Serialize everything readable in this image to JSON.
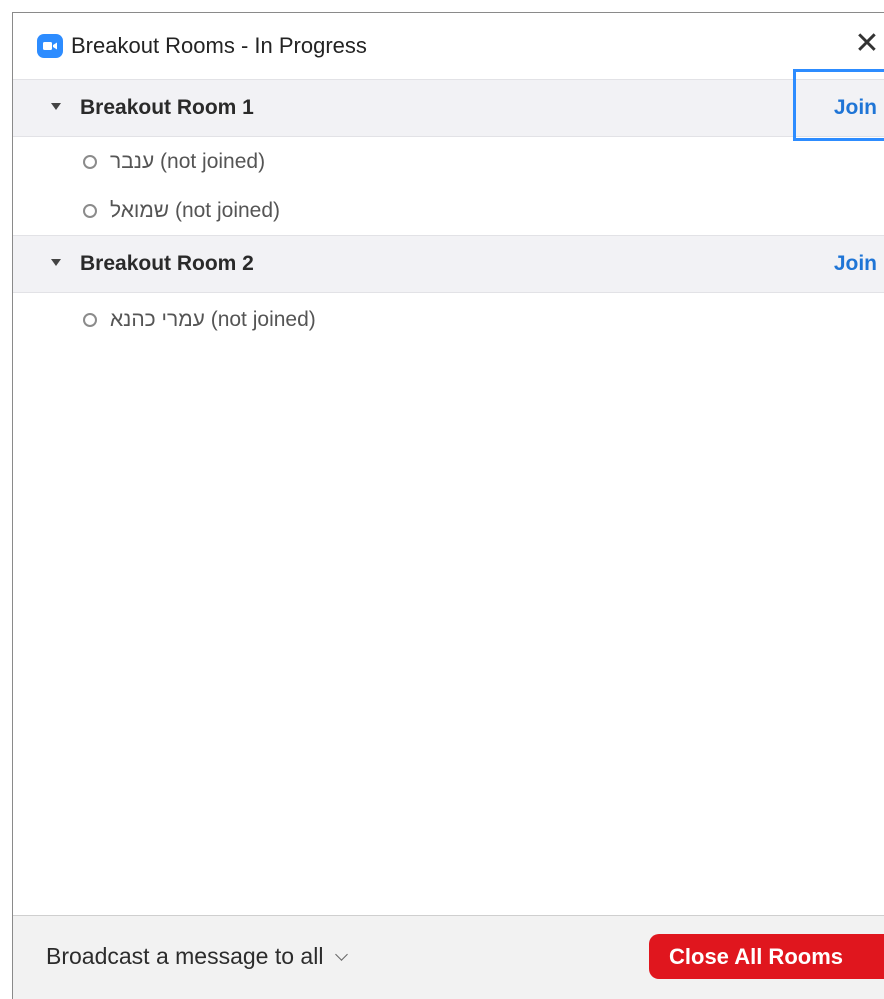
{
  "window": {
    "title": "Breakout Rooms - In Progress",
    "close_symbol": "✕"
  },
  "rooms": [
    {
      "name": "Breakout Room 1",
      "join_label": "Join",
      "participants": [
        {
          "name": "ענבר",
          "status": "(not joined)"
        },
        {
          "name": "שמואל",
          "status": "(not joined)"
        }
      ]
    },
    {
      "name": "Breakout Room 2",
      "join_label": "Join",
      "participants": [
        {
          "name": "עמרי כהנא",
          "status": "(not joined)"
        }
      ]
    }
  ],
  "footer": {
    "broadcast_label": "Broadcast a message to all",
    "close_all_label": "Close All Rooms"
  },
  "colors": {
    "accent_blue": "#2d8cff",
    "join_text": "#1f75d6",
    "close_all_bg": "#e0161e"
  },
  "icons": {
    "app": "zoom-camera-icon",
    "close": "close-icon",
    "room_toggle": "caret-down-icon",
    "participant_status": "status-circle-icon",
    "broadcast_dropdown": "chevron-down-icon"
  }
}
